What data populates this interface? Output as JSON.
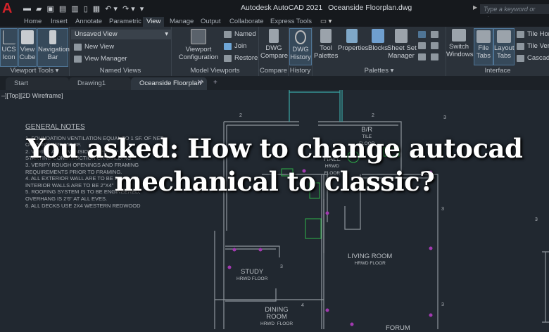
{
  "app": {
    "name": "Autodesk AutoCAD 2021",
    "file": "Oceanside Floorplan.dwg",
    "search_placeholder": "Type a keyword or phrase",
    "logo": "A"
  },
  "quick_access": [
    "new",
    "open",
    "save",
    "save-as",
    "publish",
    "share",
    "plot",
    "undo",
    "redo",
    "customize"
  ],
  "menu_tabs": [
    "Home",
    "Insert",
    "Annotate",
    "Parametric",
    "View",
    "Manage",
    "Output",
    "Collaborate",
    "Express Tools"
  ],
  "active_tab": "View",
  "ribbon": {
    "viewport_tools": {
      "label": "Viewport Tools",
      "buttons": [
        "UCS\nIcon",
        "View\nCube",
        "Navigation\nBar"
      ]
    },
    "named_views": {
      "label": "Named Views",
      "dropdown": "Unsaved View",
      "items": [
        "New View",
        "View Manager"
      ]
    },
    "model_viewports": {
      "label": "Model Viewports",
      "config": "Viewport\nConfiguration",
      "items": [
        "Named",
        "Join",
        "Restore"
      ]
    },
    "compare": {
      "label": "Compare",
      "button": "DWG\nCompare"
    },
    "history": {
      "label": "History",
      "button": "DWG\nHistory"
    },
    "palettes": {
      "label": "Palettes",
      "buttons": [
        "Tool\nPalettes",
        "Properties",
        "Blocks",
        "Sheet Set\nManager"
      ]
    },
    "interface": {
      "label": "Interface",
      "buttons": [
        "Switch\nWindows",
        "File\nTabs",
        "Layout\nTabs"
      ],
      "items": [
        "Tile Horizontally",
        "Tile Vertically",
        "Cascade"
      ]
    }
  },
  "doc_tabs": [
    "Start",
    "Drawing1",
    "Oceanside Floorplan*"
  ],
  "viewport_label": "–][Top][2D Wireframe]",
  "notes": {
    "title": "GENERAL NOTES",
    "items": [
      "1.  FOUNDATION VENTILATION EQUAL TO 1 SF. OF NET",
      "     OPENING PER 150 SF.",
      "2.  VERIFY ALL DIMENSIONS BEFORE",
      "     STARTING CONSTRUCTION OR BUILDING.",
      "3.  VERIFY ROUGH OPENINGS AND FRAMING",
      "     REQUIREMENTS PRIOR TO FRAMING.",
      "4.  ALL EXTERIOR WALL ARE TO BE 2\"X6\", ALL",
      "     INTERIOR WALLS ARE TO BE 2\"X4\"",
      "5.  ROOFING SYSTEM IS TO BE ENGINEERED,",
      "     OVERHANG IS 2'6\" AT ALL EVES.",
      "6.  ALL DECKS USE 2X4 WESTERN REDWOOD"
    ]
  },
  "rooms": [
    {
      "name": "B/R",
      "sub": "TILE\nFLOOR"
    },
    {
      "name": "HALL",
      "sub": "HRWD\nFLOOR"
    },
    {
      "name": "LIVING  ROOM",
      "sub": "HRWD  FLOOR"
    },
    {
      "name": "STUDY",
      "sub": "HRWD  FLOOR"
    },
    {
      "name": "DINING\nROOM",
      "sub": "HRWD  FLOOR"
    },
    {
      "name": "FORUM",
      "sub": ""
    }
  ],
  "headline": {
    "line1": "You asked: How to change autocad",
    "line2": "mechanical to classic?"
  },
  "colors": {
    "background": "#212830",
    "ribbon": "#2b323a",
    "wall": "#8f969d",
    "cyan": "#3aa6a6",
    "green": "#2fb34a",
    "magenta": "#a23ab0"
  }
}
